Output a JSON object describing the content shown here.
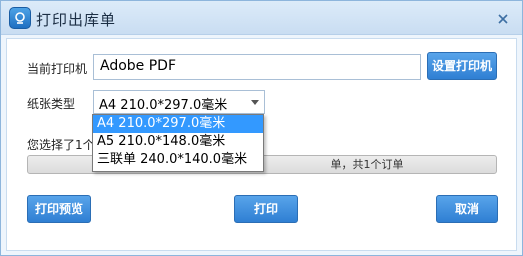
{
  "window": {
    "title": "打印出库单"
  },
  "printer": {
    "label": "当前打印机",
    "value": "Adobe PDF",
    "setup_button": "设置打印机"
  },
  "paper": {
    "label": "纸张类型",
    "selected": "A4  210.0*297.0毫米",
    "options": [
      "A4  210.0*297.0毫米",
      "A5  210.0*148.0毫米",
      "三联单 240.0*140.0毫米"
    ],
    "highlighted_index": 0
  },
  "status": {
    "info_text": "您选择了1个",
    "progress_text": "单，共1个订单"
  },
  "buttons": {
    "preview": "打印预览",
    "print": "打印",
    "cancel": "取消"
  },
  "colors": {
    "accent": "#3a8be0",
    "selection": "#3399ff"
  }
}
